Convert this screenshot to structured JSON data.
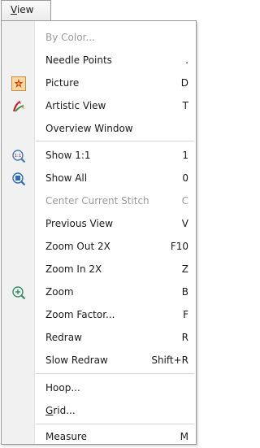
{
  "menu": {
    "title_mnemonic": "V",
    "title_rest": "iew"
  },
  "items": [
    {
      "label": "By Color...",
      "shortcut": ""
    },
    {
      "label": "Needle Points",
      "shortcut": "."
    },
    {
      "label": "Picture",
      "shortcut": "D",
      "icon": "picture-icon"
    },
    {
      "label": "Artistic View",
      "shortcut": "T",
      "icon": "artistic-view-icon"
    },
    {
      "label": "Overview Window",
      "shortcut": ""
    },
    {
      "label": "Show 1:1",
      "shortcut": "1",
      "icon": "zoom-1to1-icon"
    },
    {
      "label": "Show All",
      "shortcut": "0",
      "icon": "zoom-all-icon"
    },
    {
      "label": "Center Current Stitch",
      "shortcut": "C"
    },
    {
      "label": "Previous View",
      "shortcut": "V"
    },
    {
      "label": "Zoom Out 2X",
      "shortcut": "F10"
    },
    {
      "label": "Zoom In 2X",
      "shortcut": "Z"
    },
    {
      "label": "Zoom",
      "shortcut": "B",
      "icon": "zoom-icon"
    },
    {
      "label": "Zoom Factor...",
      "shortcut": "F"
    },
    {
      "label": "Redraw",
      "shortcut": "R"
    },
    {
      "label": "Slow Redraw",
      "shortcut": "Shift+R"
    },
    {
      "label": "Hoop...",
      "shortcut": ""
    },
    {
      "label_mnemonic": "G",
      "label_rest": "rid...",
      "shortcut": ""
    },
    {
      "label": "Measure",
      "shortcut": "M"
    }
  ]
}
